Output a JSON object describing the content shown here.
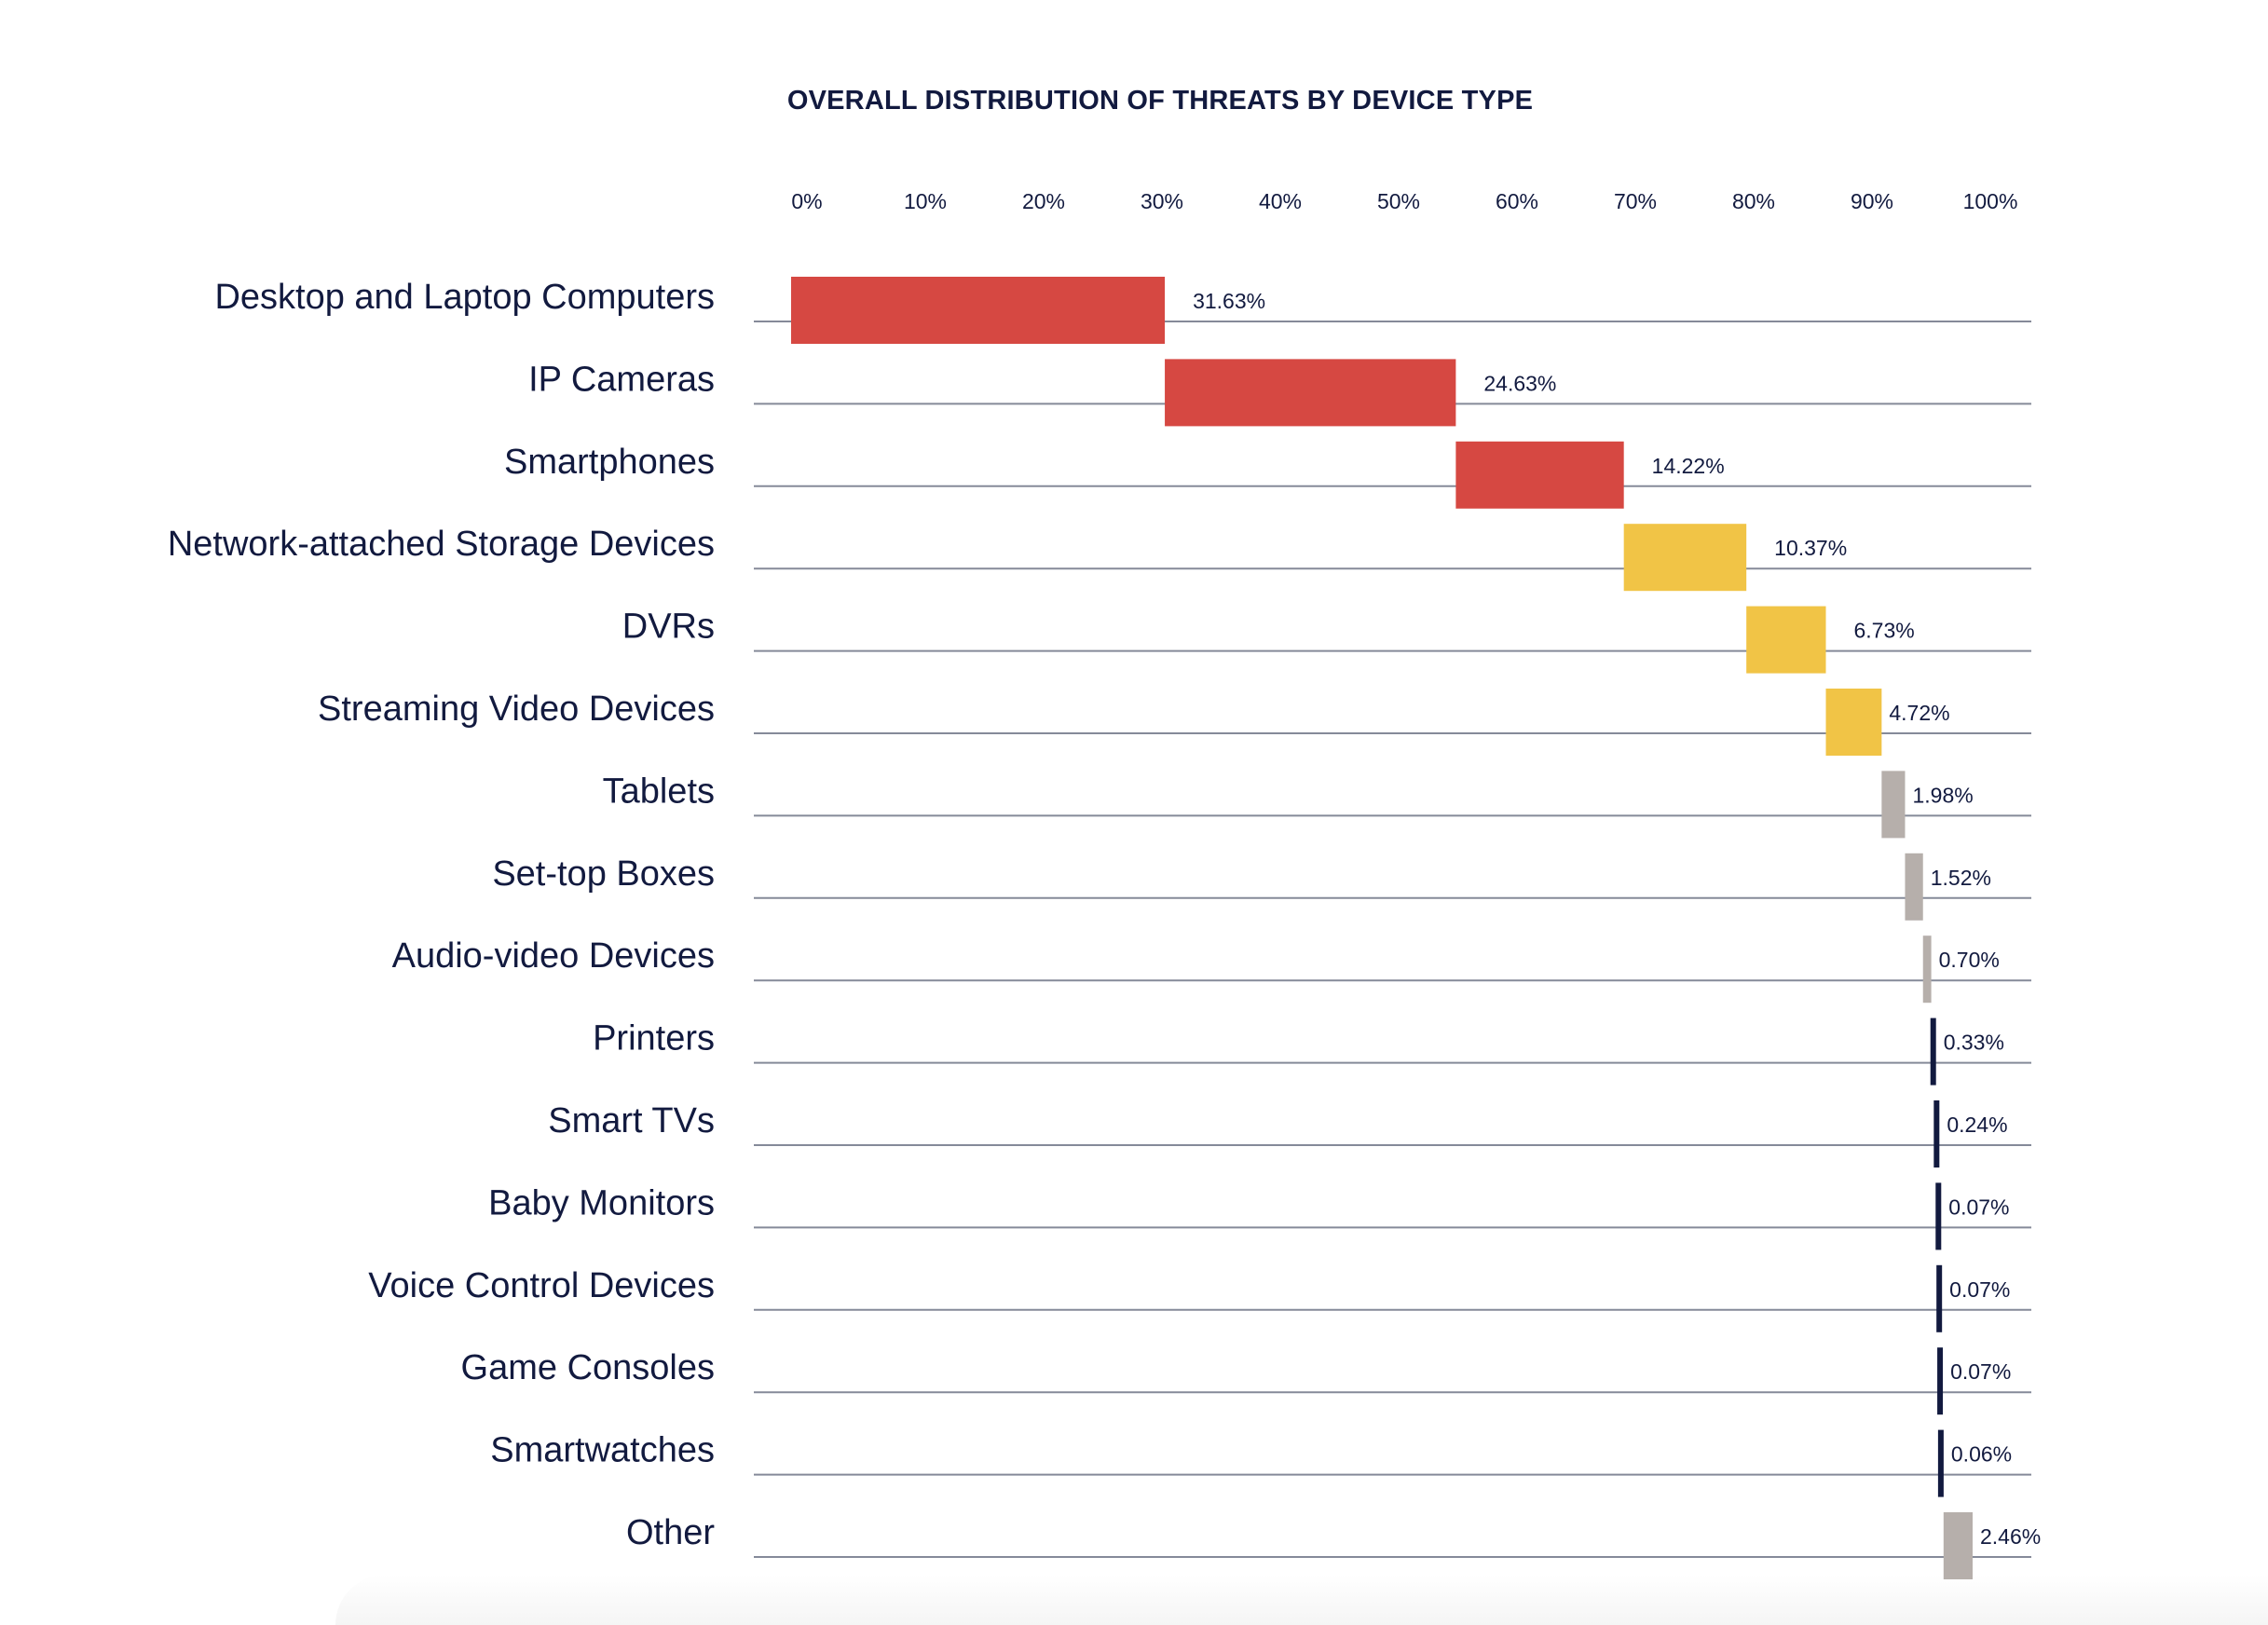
{
  "chart_data": {
    "type": "bar",
    "subtype": "waterfall-horizontal",
    "title": "OVERALL DISTRIBUTION OF THREATS BY DEVICE TYPE",
    "xlabel": "",
    "ylabel": "",
    "xlim": [
      0,
      100
    ],
    "x_ticks": [
      "0%",
      "10%",
      "20%",
      "30%",
      "40%",
      "50%",
      "60%",
      "70%",
      "80%",
      "90%",
      "100%"
    ],
    "grid": "horizontal row baselines",
    "legend": "none",
    "colors": {
      "high": "#d64842",
      "medium": "#f1c446",
      "low": "#b6afab",
      "minimal": "#121a3f"
    },
    "categories": [
      "Desktop and Laptop Computers",
      "IP Cameras",
      "Smartphones",
      "Network-attached Storage Devices",
      "DVRs",
      "Streaming Video Devices",
      "Tablets",
      "Set-top Boxes",
      "Audio-video Devices",
      "Printers",
      "Smart TVs",
      "Baby Monitors",
      "Voice Control Devices",
      "Game Consoles",
      "Smartwatches",
      "Other"
    ],
    "values": [
      31.63,
      24.63,
      14.22,
      10.37,
      6.73,
      4.72,
      1.98,
      1.52,
      0.7,
      0.33,
      0.24,
      0.07,
      0.07,
      0.07,
      0.06,
      2.46
    ],
    "value_labels": [
      "31.63%",
      "24.63%",
      "14.22%",
      "10.37%",
      "6.73%",
      "4.72%",
      "1.98%",
      "1.52%",
      "0.70%",
      "0.33%",
      "0.24%",
      "0.07%",
      "0.07%",
      "0.07%",
      "0.06%",
      "2.46%"
    ],
    "tiers": [
      "high",
      "high",
      "high",
      "medium",
      "medium",
      "medium",
      "low",
      "low",
      "low",
      "minimal",
      "minimal",
      "minimal",
      "minimal",
      "minimal",
      "minimal",
      "low"
    ]
  }
}
